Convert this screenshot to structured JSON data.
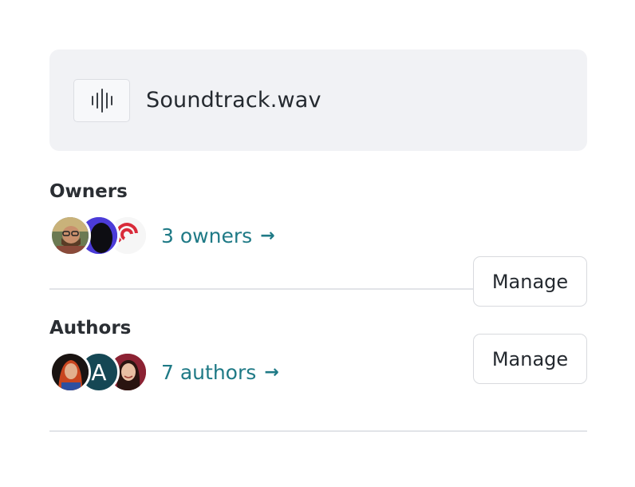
{
  "file": {
    "name": "Soundtrack.wav",
    "icon": "audio-waveform-icon"
  },
  "owners": {
    "title": "Owners",
    "count_label": "3 owners",
    "arrow": "→",
    "manage_label": "Manage",
    "avatars": [
      "avatar-person-glasses",
      "avatar-dark-figure",
      "avatar-red-ear-logo"
    ]
  },
  "authors": {
    "title": "Authors",
    "count_label": "7 authors",
    "arrow": "→",
    "manage_label": "Manage",
    "avatars": [
      "avatar-redhead-person",
      "avatar-letter-a",
      "avatar-smiling-woman"
    ],
    "letter_avatar": "A"
  },
  "colors": {
    "link": "#1f7a86",
    "card_bg": "#f1f2f5",
    "divider": "#e2e4e8"
  }
}
